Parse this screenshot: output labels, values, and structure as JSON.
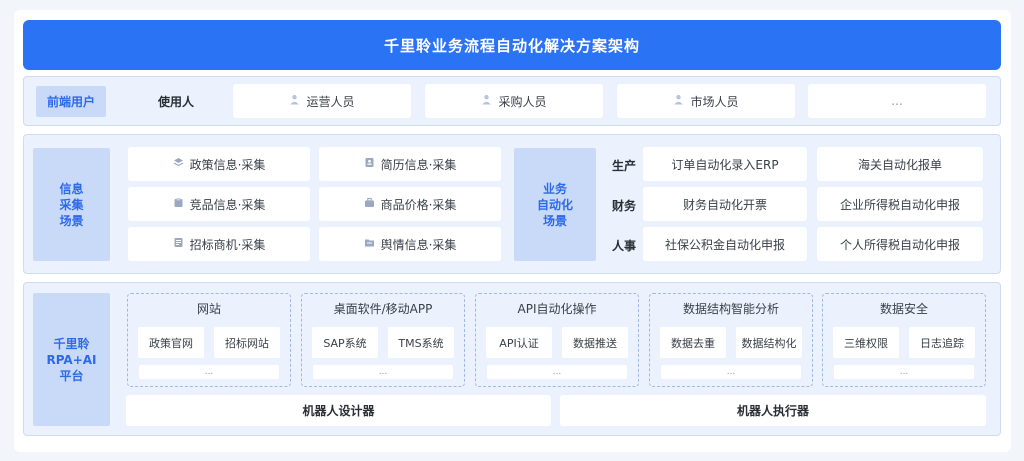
{
  "title": "千里聆业务流程自动化解决方案架构",
  "users": {
    "tag": "前端用户",
    "label": "使用人",
    "items": [
      "运营人员",
      "采购人员",
      "市场人员",
      "..."
    ],
    "icon": "user-icon"
  },
  "info_scenario": {
    "tag": [
      "信息",
      "采集",
      "场景"
    ],
    "items": [
      {
        "label": "政策信息·采集",
        "icon": "layers-icon"
      },
      {
        "label": "简历信息·采集",
        "icon": "resume-icon"
      },
      {
        "label": "竞品信息·采集",
        "icon": "product-icon"
      },
      {
        "label": "商品价格·采集",
        "icon": "briefcase-icon"
      },
      {
        "label": "招标商机·采集",
        "icon": "document-icon"
      },
      {
        "label": "舆情信息·采集",
        "icon": "folder-icon"
      }
    ]
  },
  "business_scenario": {
    "tag": [
      "业务",
      "自动化",
      "场景"
    ],
    "rows": [
      {
        "category": "生产",
        "items": [
          "订单自动化录入ERP",
          "海关自动化报单"
        ]
      },
      {
        "category": "财务",
        "items": [
          "财务自动化开票",
          "企业所得税自动化申报"
        ]
      },
      {
        "category": "人事",
        "items": [
          "社保公积金自动化申报",
          "个人所得税自动化申报"
        ]
      }
    ]
  },
  "platform": {
    "tag": [
      "千里聆",
      "RPA+AI",
      "平台"
    ],
    "modules": [
      {
        "title": "网站",
        "items": [
          "政策官网",
          "招标网站"
        ],
        "more": "..."
      },
      {
        "title": "桌面软件/移动APP",
        "items": [
          "SAP系统",
          "TMS系统"
        ],
        "more": "..."
      },
      {
        "title": "API自动化操作",
        "items": [
          "API认证",
          "数据推送"
        ],
        "more": "..."
      },
      {
        "title": "数据结构智能分析",
        "items": [
          "数据去重",
          "数据结构化"
        ],
        "more": "..."
      },
      {
        "title": "数据安全",
        "items": [
          "三维权限",
          "日志追踪"
        ],
        "more": "..."
      }
    ],
    "bars": [
      "机器人设计器",
      "机器人执行器"
    ]
  },
  "colors": {
    "title_bg": "#2b73f5",
    "band_bg": "#ecf2fd",
    "tag_bg": "#c9daf9",
    "tag_text": "#2d6ae8",
    "box_bg": "#ffffff"
  }
}
